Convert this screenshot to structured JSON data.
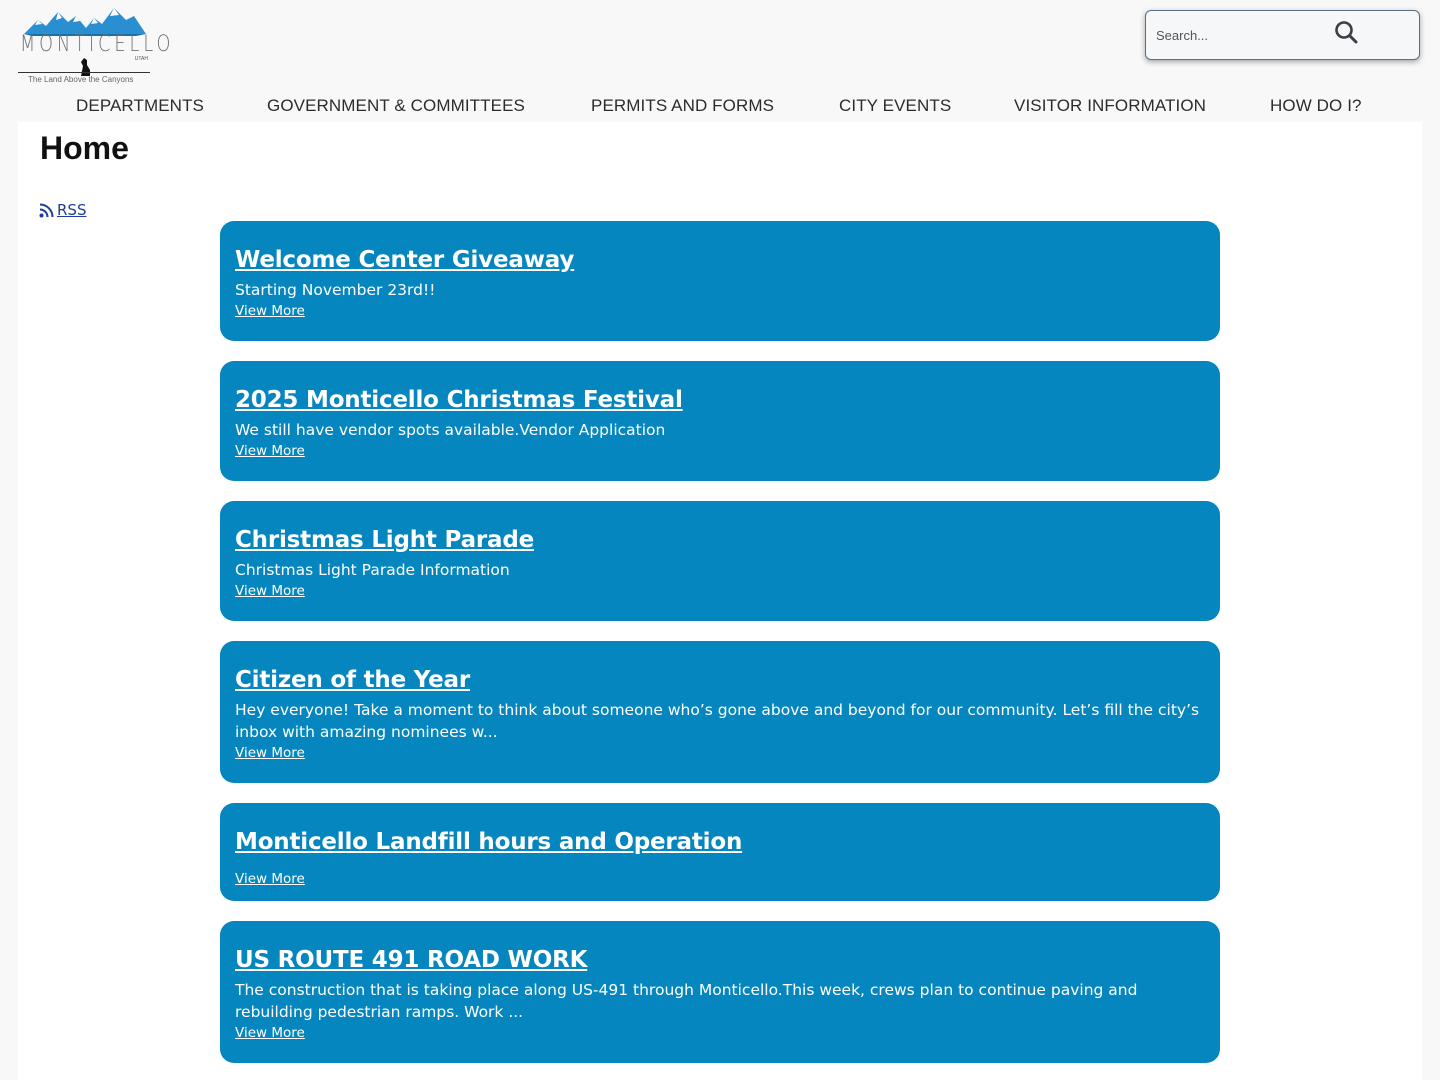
{
  "logo": {
    "wordmark": "MONTICELLO",
    "state": "UTAH",
    "tagline": "The Land Above the Canyons"
  },
  "search": {
    "placeholder": "Search..."
  },
  "nav": {
    "items": [
      {
        "label": "DEPARTMENTS"
      },
      {
        "label": "GOVERNMENT & COMMITTEES"
      },
      {
        "label": "PERMITS AND FORMS"
      },
      {
        "label": "CITY EVENTS"
      },
      {
        "label": "VISITOR INFORMATION"
      },
      {
        "label": "HOW DO I?"
      }
    ]
  },
  "page": {
    "title": "Home",
    "rss_label": "RSS"
  },
  "cards": [
    {
      "title": "Welcome Center Giveaway",
      "desc": "Starting November 23rd!!",
      "more": "View More"
    },
    {
      "title": "2025 Monticello Christmas Festival",
      "desc": "We still have vendor spots available.Vendor Application",
      "more": "View More"
    },
    {
      "title": "Christmas Light Parade",
      "desc": "Christmas Light Parade Information",
      "more": "View More"
    },
    {
      "title": "Citizen of the Year",
      "desc": "Hey everyone! Take a moment to think about someone who’s gone above and beyond for our community. Let’s fill the city’s inbox with amazing nominees w...",
      "more": "View More"
    },
    {
      "title": "Monticello Landfill hours and Operation",
      "desc": "",
      "more": "View More"
    },
    {
      "title": "US ROUTE 491 ROAD WORK",
      "desc": "The construction that is taking place along US-491 through Monticello.This week, crews plan to continue paving and rebuilding pedestrian ramps. Work ...",
      "more": "View More"
    }
  ],
  "colors": {
    "card_bg": "#0586bf",
    "link_blue": "#1f3c9e",
    "page_bg": "#f8f8f8"
  }
}
